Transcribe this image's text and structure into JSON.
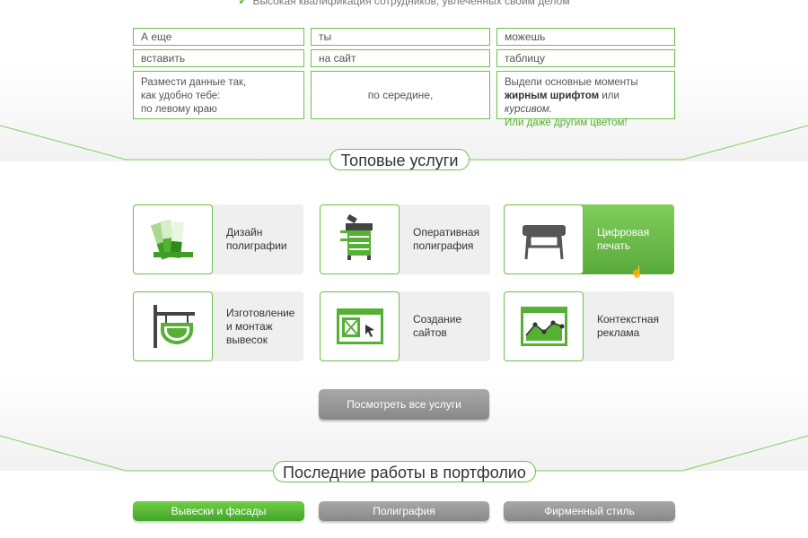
{
  "top_strip": {
    "mark": "✔",
    "text": "Высокая квалификация сотрудников, увлеченных своим делом"
  },
  "text_grid": {
    "row1": [
      "А еще",
      "ты",
      "можешь"
    ],
    "row2": [
      "вставить",
      "на сайт",
      "таблицу"
    ],
    "left_lines": [
      "Размести данные так,",
      "как удобно тебе:",
      "по левому краю"
    ],
    "center_text": "по середине,",
    "right": {
      "line1": "Выдели основные моменты",
      "bold": "жирным шрифтом",
      "or1": " или ",
      "italic": "курсивом.",
      "green": "Или даже другим цветом!"
    }
  },
  "services_section": {
    "title": "Топовые услуги",
    "items": [
      {
        "line1": "Дизайн",
        "line2": "полиграфии",
        "line3": "",
        "icon": "color-swatches-icon"
      },
      {
        "line1": "Оперативная",
        "line2": "полиграфия",
        "line3": "",
        "icon": "copier-icon"
      },
      {
        "line1": "Цифровая",
        "line2": "печать",
        "line3": "",
        "icon": "plotter-printer-icon"
      },
      {
        "line1": "Изготовление",
        "line2": "и монтаж",
        "line3": "вывесок",
        "icon": "hanging-sign-icon"
      },
      {
        "line1": "Создание",
        "line2": "сайтов",
        "line3": "",
        "icon": "website-window-icon"
      },
      {
        "line1": "Контекстная",
        "line2": "реклама",
        "line3": "",
        "icon": "analytics-chart-icon"
      }
    ],
    "view_all_label": "Посмотреть все услуги"
  },
  "portfolio_section": {
    "title": "Последние работы в портфолио",
    "filters": [
      "Вывески и фасады",
      "Полиграфия",
      "Фирменный стиль"
    ]
  },
  "colors": {
    "accent": "#6cc24a",
    "accent_dark": "#43a52a",
    "gray_button": "#999999"
  }
}
